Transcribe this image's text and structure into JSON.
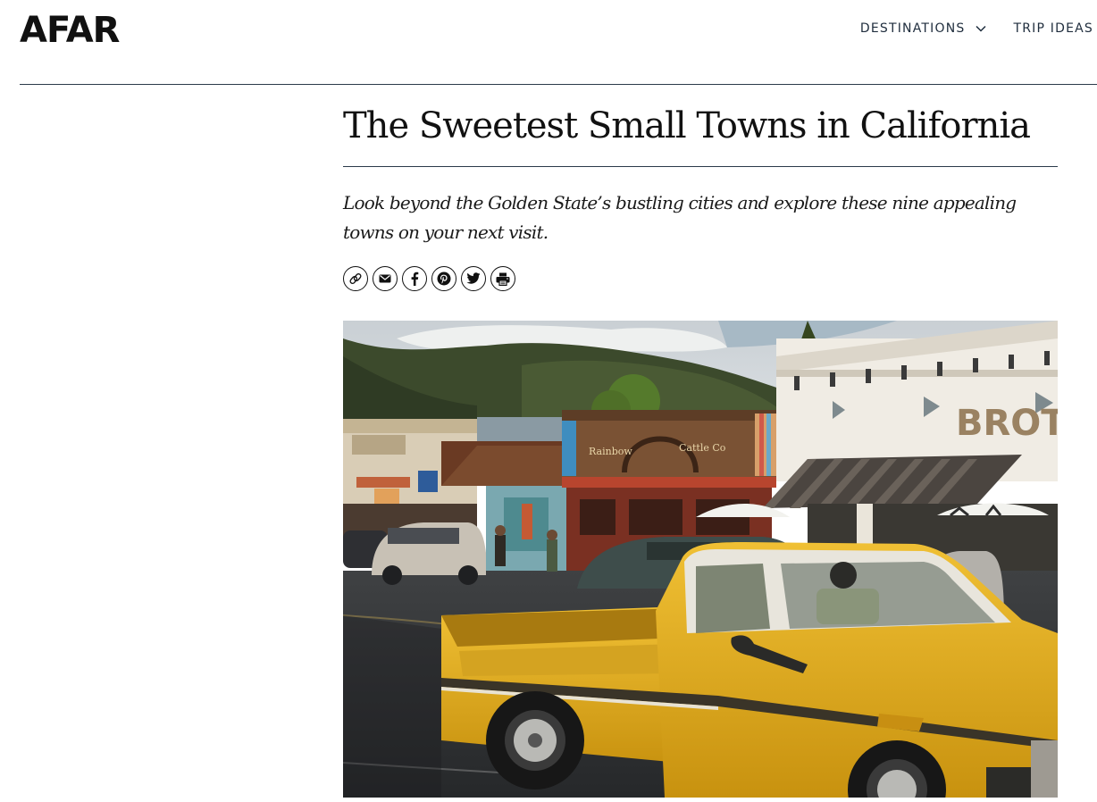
{
  "header": {
    "logo": "AFAR",
    "nav": [
      {
        "label": "DESTINATIONS",
        "has_dropdown": true
      },
      {
        "label": "TRIP IDEAS",
        "has_dropdown": false
      }
    ]
  },
  "article": {
    "title": "The Sweetest Small Towns in California",
    "dek": "Look beyond the Golden State’s bustling cities and explore these nine appealing towns on your next visit.",
    "share_icons": [
      "link-icon",
      "email-icon",
      "facebook-icon",
      "pinterest-icon",
      "twitter-icon",
      "print-icon"
    ],
    "hero_image": {
      "storefront_signs": [
        "BROT",
        "Rainbow",
        "Cattle Co"
      ],
      "scene": "small-town main street with yellow vintage pickup truck"
    }
  },
  "colors": {
    "text": "#111111",
    "nav_text": "#1f2d3d",
    "rule": "#2b3a4a",
    "truck_yellow": "#e2ad1c"
  }
}
